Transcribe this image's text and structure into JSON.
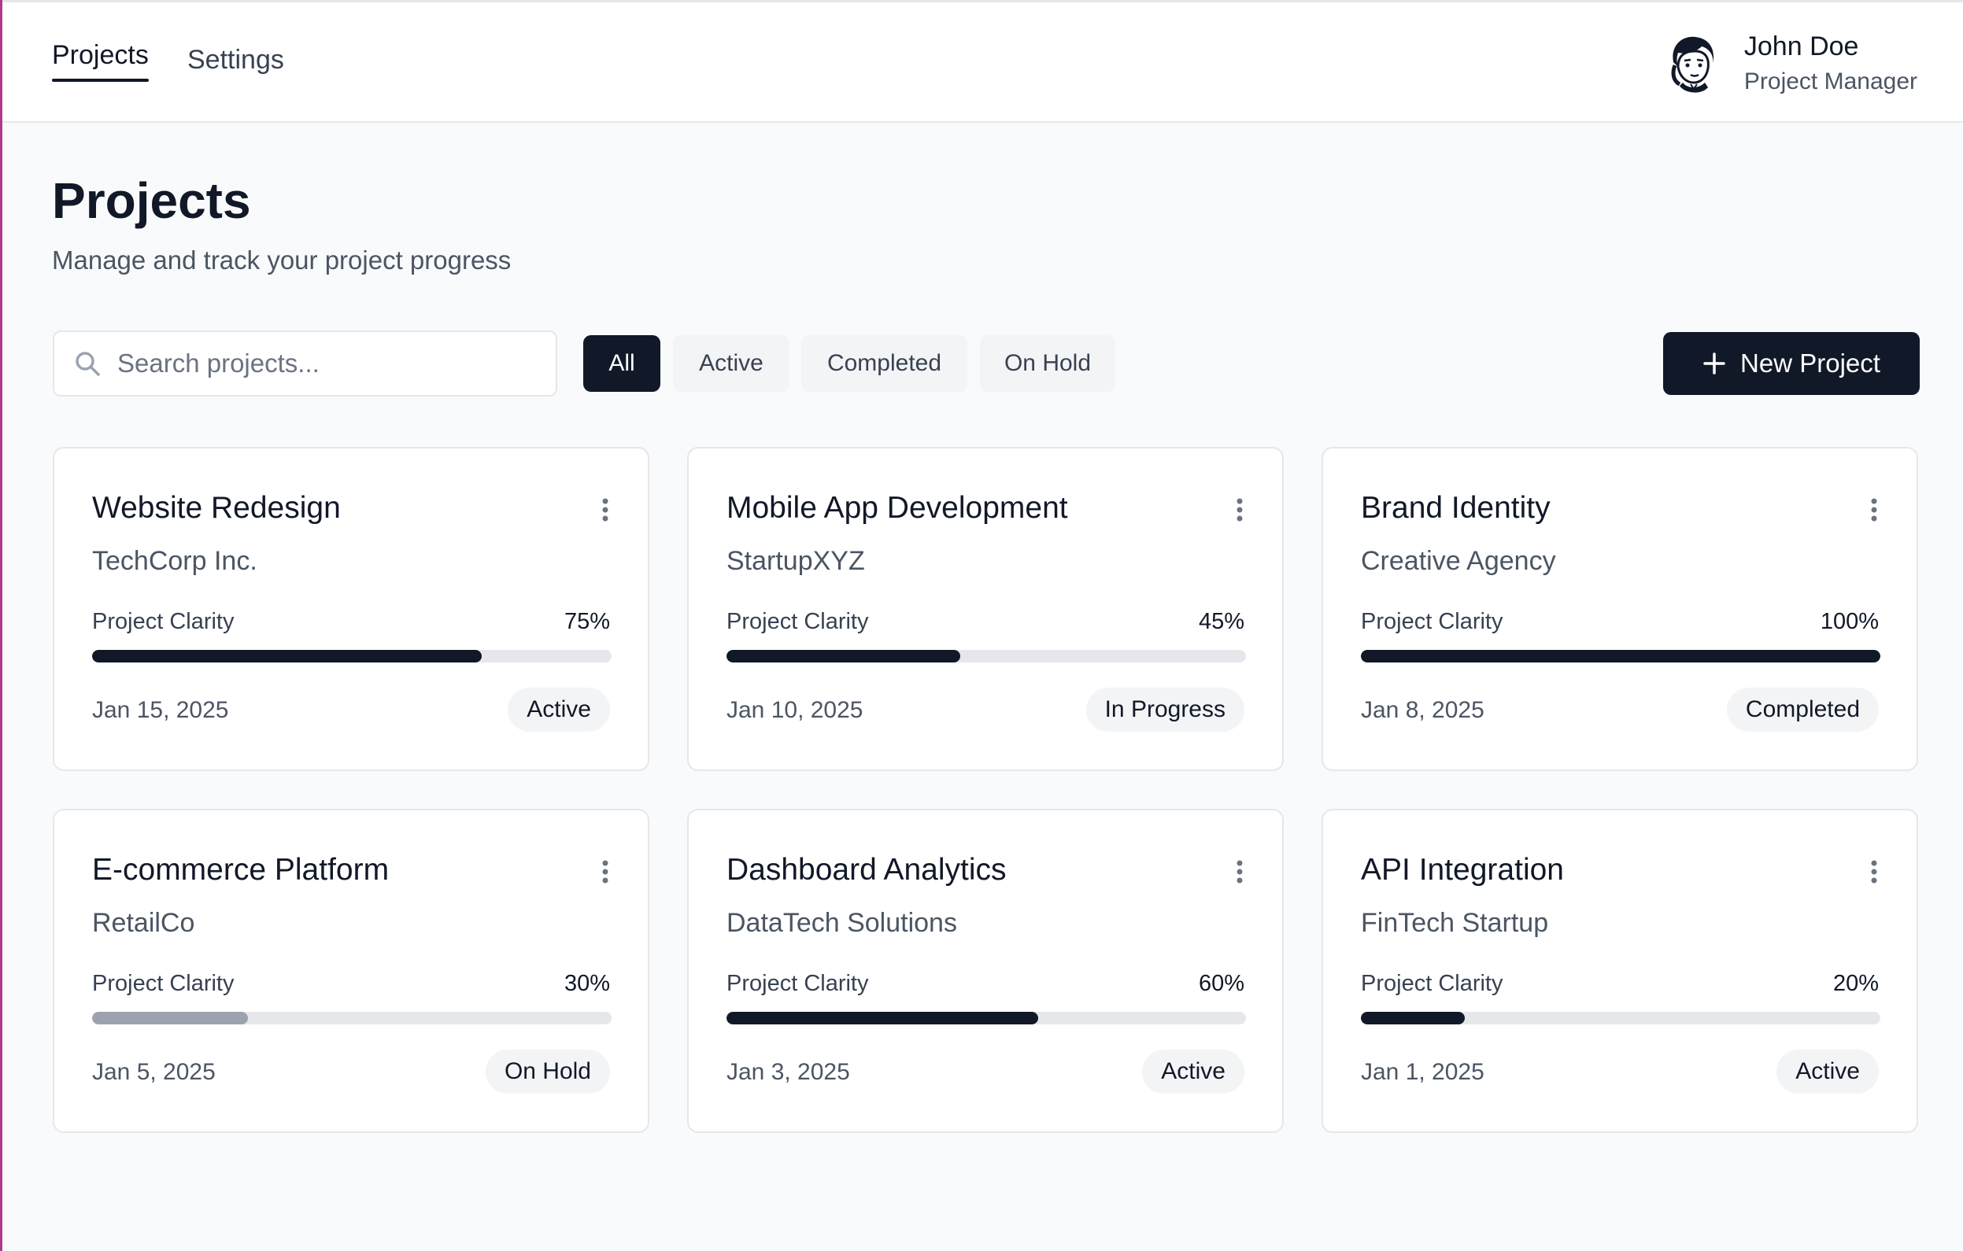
{
  "nav": {
    "tabs": [
      {
        "label": "Projects",
        "active": true
      },
      {
        "label": "Settings",
        "active": false
      }
    ]
  },
  "user": {
    "name": "John Doe",
    "role": "Project Manager",
    "avatar_icon": "avatar-illustration-icon"
  },
  "header": {
    "title": "Projects",
    "subtitle": "Manage and track your project progress"
  },
  "search": {
    "placeholder": "Search projects...",
    "value": "",
    "icon": "search-icon"
  },
  "filters": [
    {
      "label": "All",
      "active": true
    },
    {
      "label": "Active",
      "active": false
    },
    {
      "label": "Completed",
      "active": false
    },
    {
      "label": "On Hold",
      "active": false
    }
  ],
  "new_project": {
    "label": "New Project",
    "icon": "plus-icon"
  },
  "colors": {
    "accent": "#111827",
    "muted_fill": "#9ca3af",
    "track": "#e5e7eb",
    "badge_bg": "#f3f4f6"
  },
  "projects": [
    {
      "title": "Website Redesign",
      "client": "TechCorp Inc.",
      "metric_label": "Project Clarity",
      "progress_text": "75%",
      "progress": 75,
      "date": "Jan 15, 2025",
      "status": "Active"
    },
    {
      "title": "Mobile App Development",
      "client": "StartupXYZ",
      "metric_label": "Project Clarity",
      "progress_text": "45%",
      "progress": 45,
      "date": "Jan 10, 2025",
      "status": "In Progress"
    },
    {
      "title": "Brand Identity",
      "client": "Creative Agency",
      "metric_label": "Project Clarity",
      "progress_text": "100%",
      "progress": 100,
      "date": "Jan 8, 2025",
      "status": "Completed"
    },
    {
      "title": "E-commerce Platform",
      "client": "RetailCo",
      "metric_label": "Project Clarity",
      "progress_text": "30%",
      "progress": 30,
      "date": "Jan 5, 2025",
      "status": "On Hold"
    },
    {
      "title": "Dashboard Analytics",
      "client": "DataTech Solutions",
      "metric_label": "Project Clarity",
      "progress_text": "60%",
      "progress": 60,
      "date": "Jan 3, 2025",
      "status": "Active"
    },
    {
      "title": "API Integration",
      "client": "FinTech Startup",
      "metric_label": "Project Clarity",
      "progress_text": "20%",
      "progress": 20,
      "date": "Jan 1, 2025",
      "status": "Active"
    }
  ]
}
